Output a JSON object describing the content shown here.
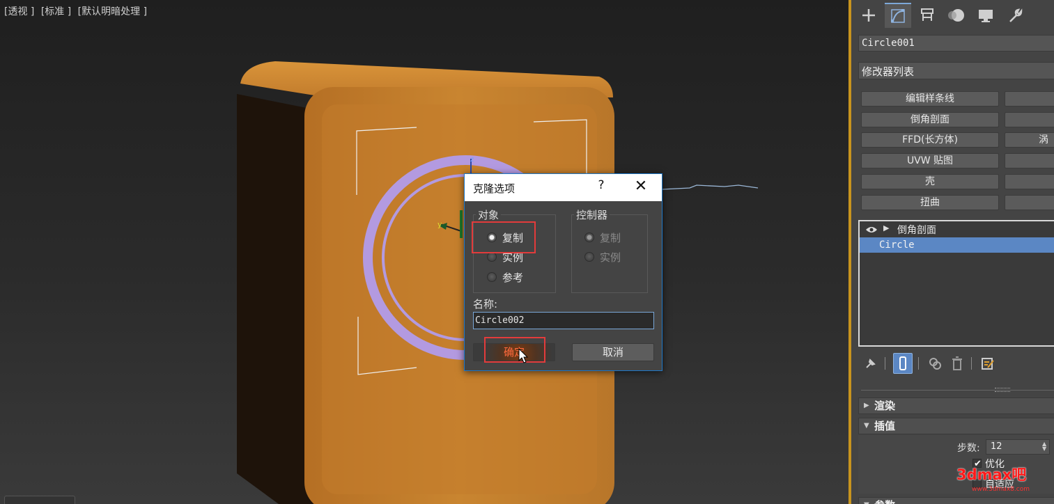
{
  "viewport": {
    "labels": [
      "[透视 ]",
      "[标准 ]",
      "[默认明暗处理 ]"
    ]
  },
  "clone_dialog": {
    "title": "克隆选项",
    "help": "?",
    "close": "✕",
    "object_group": {
      "title": "对象",
      "options": [
        {
          "label": "复制",
          "checked": true
        },
        {
          "label": "实例",
          "checked": false
        },
        {
          "label": "参考",
          "checked": false
        }
      ]
    },
    "controller_group": {
      "title": "控制器",
      "options": [
        {
          "label": "复制",
          "checked": true,
          "disabled": true
        },
        {
          "label": "实例",
          "checked": false,
          "disabled": true
        }
      ]
    },
    "name_label": "名称:",
    "name_value": "Circle002",
    "ok_label": "确定",
    "cancel_label": "取消"
  },
  "command_panel": {
    "object_name": "Circle001",
    "modifier_list": "修改器列表",
    "modifier_buttons_left": [
      "编辑样条线",
      "倒角剖面",
      "FFD(长方体)",
      "UVW 贴图",
      "壳",
      "扭曲"
    ],
    "modifier_buttons_right": [
      "",
      "",
      "涡",
      "",
      "",
      ""
    ],
    "stack": {
      "items": [
        {
          "label": "倒角剖面"
        },
        {
          "label": "Circle",
          "selected": true
        }
      ]
    },
    "rollouts": {
      "render": "渲染",
      "interpolation": "插值",
      "params": "参数"
    },
    "interpolation": {
      "steps_label": "步数:",
      "steps_value": "12",
      "optimize_label": "优化",
      "optimize_checked": true,
      "adaptive_label": "自适应",
      "adaptive_checked": false
    }
  },
  "watermark": {
    "text": "3dmax吧",
    "sub": "www.3dmax8.com"
  },
  "colors": {
    "accent_blue": "#5b87c4",
    "highlight_red": "#e33b3b",
    "cabinet_orange": "#c07a28",
    "ring_lavender": "#b39ae0"
  }
}
